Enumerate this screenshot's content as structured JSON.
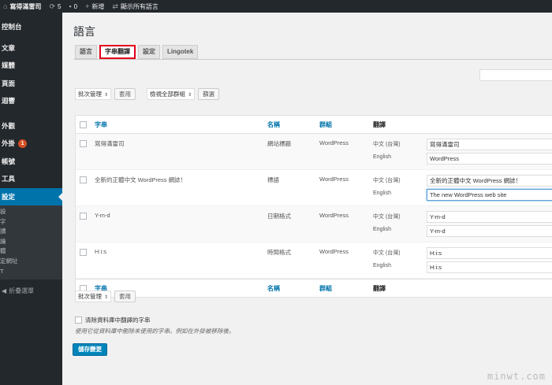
{
  "adminbar": {
    "site_name": "寫得滿雷司",
    "updates_count": "5",
    "comments_count": "0",
    "new_label": "新增",
    "show_all_languages": "顯示所有語言"
  },
  "sidebar": {
    "items": [
      {
        "label": "控制台"
      },
      {
        "label": "文章"
      },
      {
        "label": "媒體"
      },
      {
        "label": "頁面"
      },
      {
        "label": "迴響"
      },
      {
        "label": "外觀"
      },
      {
        "label": "外掛",
        "badge": "1"
      },
      {
        "label": "帳號"
      },
      {
        "label": "工具"
      },
      {
        "label": "設定"
      }
    ],
    "submenu": [
      "設",
      "字",
      "讀",
      "論",
      "體",
      "定網址",
      "T"
    ],
    "collapse_label": "折疊選單"
  },
  "page": {
    "title": "語言",
    "tabs": [
      "語言",
      "字串翻譯",
      "設定",
      "Lingotek"
    ],
    "active_tab": "字串翻譯"
  },
  "toolbar_top": {
    "bulk_action": "批次管理",
    "apply": "套用",
    "group_filter": "檢視全部群組",
    "filter": "篩選"
  },
  "table": {
    "headers": {
      "string": "字串",
      "name": "名稱",
      "group": "群組",
      "translation": "翻譯"
    },
    "rows": [
      {
        "string": "寫得滿雷司",
        "name": "網站標題",
        "group": "WordPress",
        "lang1": "中文 (台灣)",
        "val1": "寫得滿雷司",
        "lang2": "English",
        "val2": "WordPress"
      },
      {
        "string": "全新的正體中文 WordPress 網誌！",
        "name": "標語",
        "group": "WordPress",
        "lang1": "中文 (台灣)",
        "val1": "全新的正體中文 WordPress 網誌！",
        "lang2": "English",
        "val2": "The new WordPress web site"
      },
      {
        "string": "Y-m-d",
        "name": "日期格式",
        "group": "WordPress",
        "lang1": "中文 (台灣)",
        "val1": "Y-m-d",
        "lang2": "English",
        "val2": "Y-m-d"
      },
      {
        "string": "H:i:s",
        "name": "時間格式",
        "group": "WordPress",
        "lang1": "中文 (台灣)",
        "val1": "H:i:s",
        "lang2": "English",
        "val2": "H:i:s"
      }
    ]
  },
  "toolbar_bottom": {
    "bulk_action": "批次管理",
    "apply": "套用"
  },
  "clean": {
    "label": "清除資料庫中翻譯的字串",
    "description": "使用它從資料庫中刪除未使用的字串。例如在外掛被移除後。"
  },
  "save_label": "儲存變更",
  "watermark": "minwt.com"
}
